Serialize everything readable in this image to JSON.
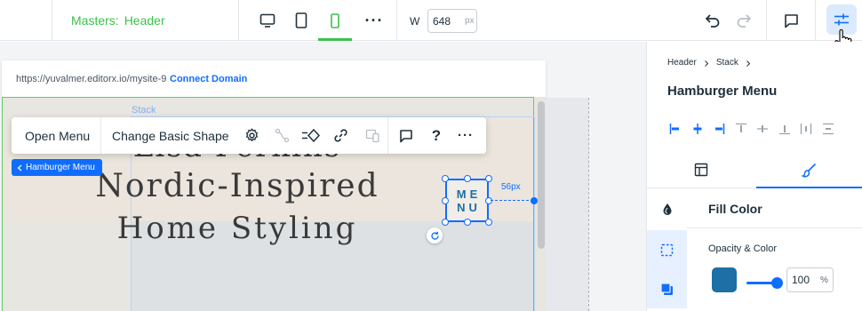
{
  "topbar": {
    "masters_label": "Masters:",
    "masters_value": "Header",
    "width_label": "W",
    "width_value": "648",
    "width_unit": "px",
    "more": "···"
  },
  "canvas": {
    "url": "https://yuvalmer.editorx.io/mysite-9",
    "connect_domain": "Connect Domain",
    "stack_label": "Stack",
    "title_lines": [
      "Lisa Perkins",
      "Nordic-Inspired",
      "Home Styling"
    ],
    "menu_box_lines": [
      "ME",
      "NU"
    ],
    "spacing": "56px",
    "hamburger_tag": "Hamburger Menu"
  },
  "float_toolbar": {
    "open_menu": "Open Menu",
    "change_shape": "Change Basic Shape",
    "help": "?",
    "more": "···"
  },
  "panel": {
    "breadcrumb": [
      "Header",
      "Stack"
    ],
    "title": "Hamburger Menu",
    "fill_title": "Fill Color",
    "opacity_label": "Opacity & Color",
    "opacity_value": "100",
    "opacity_unit": "%",
    "fill_color": "#1d6fa6",
    "opacity_level": 1.0
  },
  "colors": {
    "accent": "#116dff",
    "master_green": "#3ac14a",
    "text": "#20303c"
  }
}
